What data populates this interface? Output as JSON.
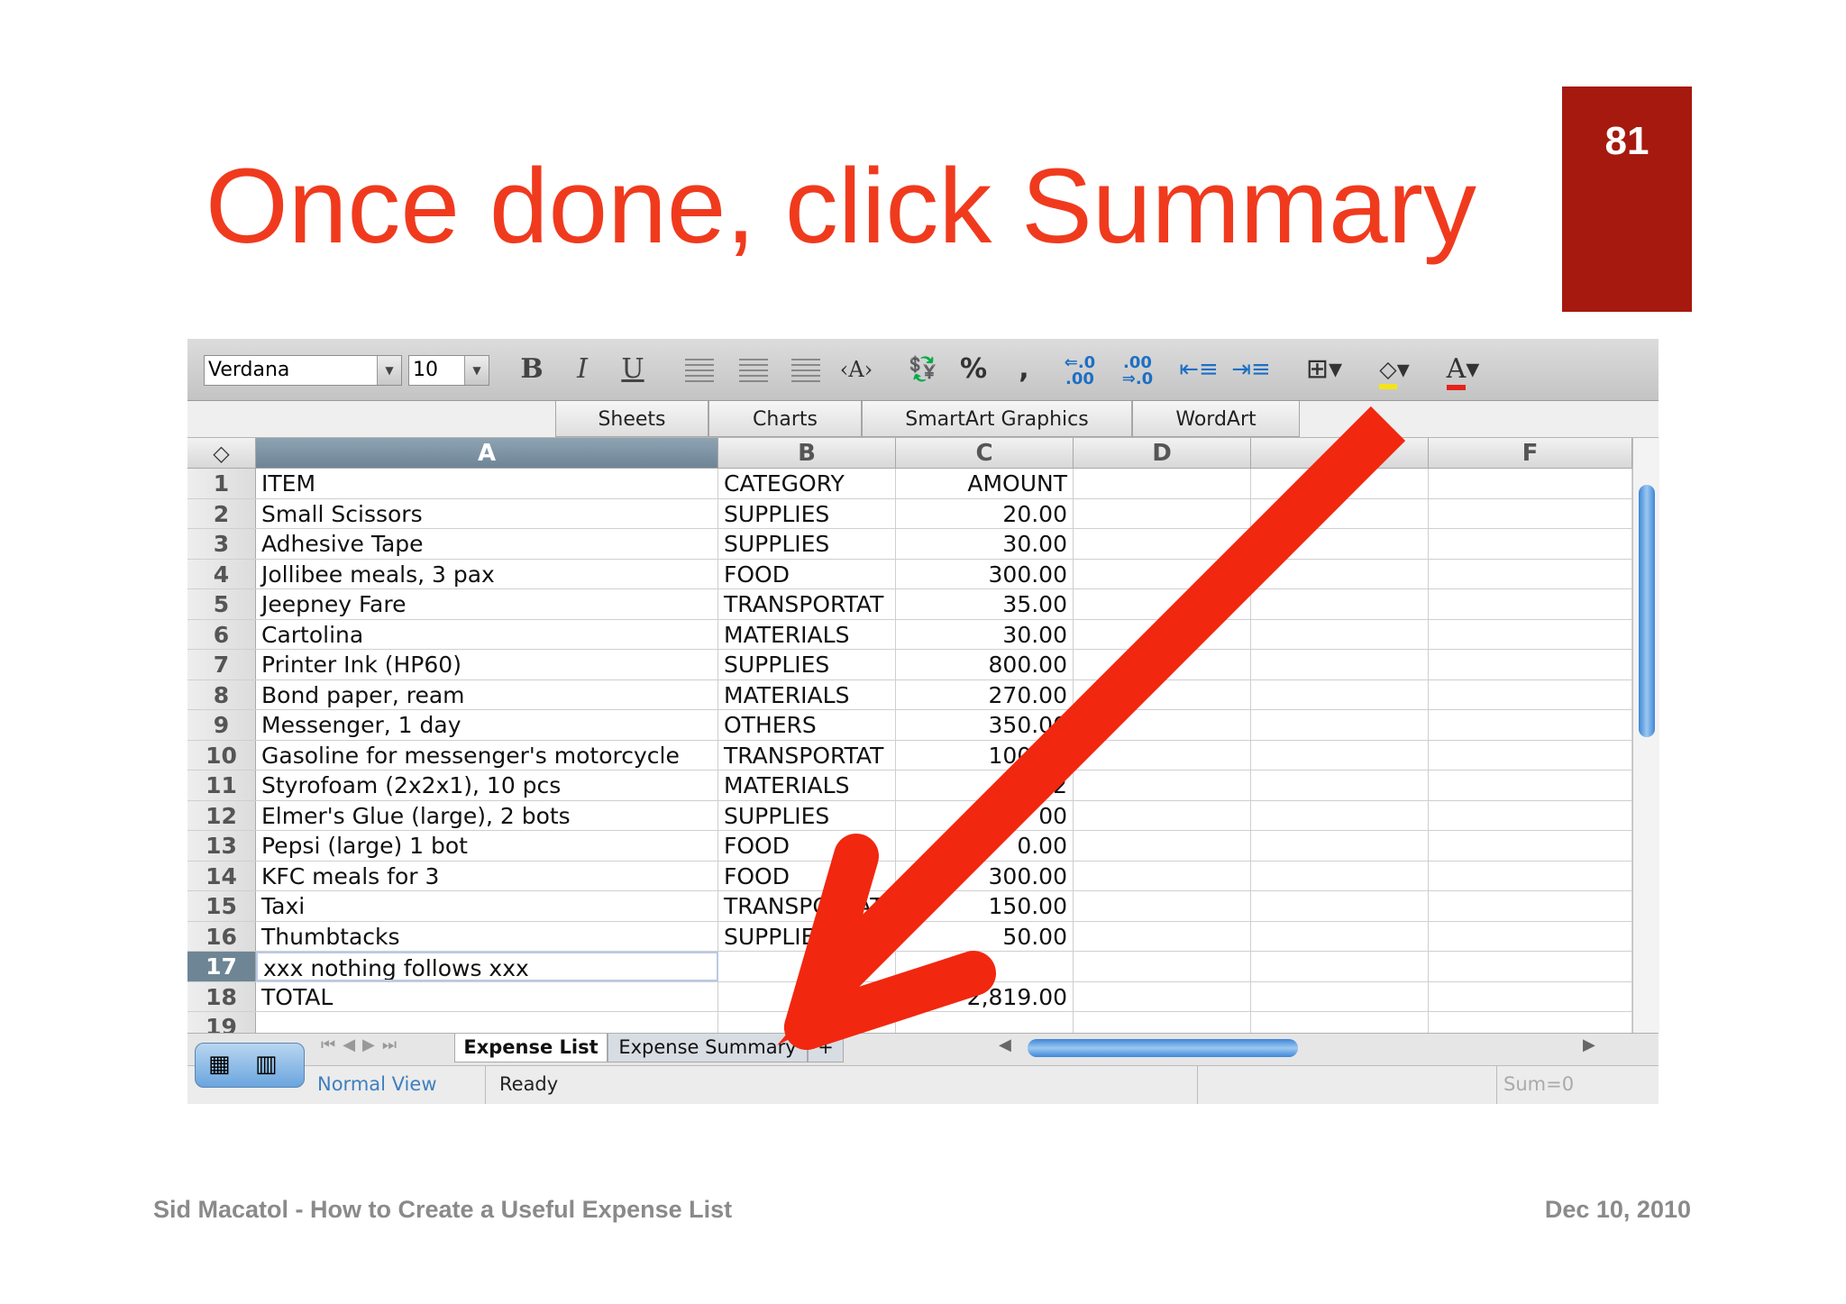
{
  "slide": {
    "title": "Once done, click Summary",
    "page_number": "81",
    "footer_left": "Sid Macatol - How to Create a Useful Expense List",
    "footer_right": "Dec 10, 2010"
  },
  "toolbar": {
    "font_name": "Verdana",
    "font_size": "10",
    "bold": "B",
    "italic": "I",
    "underline": "U",
    "percent": "%",
    "comma": ",",
    "font_color": "A"
  },
  "gallery_tabs": [
    "Sheets",
    "Charts",
    "SmartArt Graphics",
    "WordArt"
  ],
  "columns": [
    "A",
    "B",
    "C",
    "D",
    "E",
    "F"
  ],
  "rows": [
    {
      "n": "1",
      "a": "ITEM",
      "b": "CATEGORY",
      "c": "AMOUNT"
    },
    {
      "n": "2",
      "a": "Small Scissors",
      "b": "SUPPLIES",
      "c": "20.00"
    },
    {
      "n": "3",
      "a": "Adhesive Tape",
      "b": "SUPPLIES",
      "c": "30.00"
    },
    {
      "n": "4",
      "a": "Jollibee meals, 3 pax",
      "b": "FOOD",
      "c": "300.00"
    },
    {
      "n": "5",
      "a": "Jeepney Fare",
      "b": "TRANSPORTAT",
      "c": "35.00"
    },
    {
      "n": "6",
      "a": "Cartolina",
      "b": "MATERIALS",
      "c": "30.00"
    },
    {
      "n": "7",
      "a": "Printer Ink (HP60)",
      "b": "SUPPLIES",
      "c": "800.00"
    },
    {
      "n": "8",
      "a": "Bond paper,  ream",
      "b": "MATERIALS",
      "c": "270.00"
    },
    {
      "n": "9",
      "a": "Messenger, 1 day",
      "b": "OTHERS",
      "c": "350.00"
    },
    {
      "n": "10",
      "a": "Gasoline for messenger's motorcycle",
      "b": "TRANSPORTAT",
      "c": "100.00"
    },
    {
      "n": "11",
      "a": "Styrofoam (2x2x1), 10 pcs",
      "b": "MATERIALS",
      "c": "22"
    },
    {
      "n": "12",
      "a": "Elmer's Glue (large), 2 bots",
      "b": "SUPPLIES",
      "c": "00"
    },
    {
      "n": "13",
      "a": "Pepsi (large) 1 bot",
      "b": "FOOD",
      "c": "0.00"
    },
    {
      "n": "14",
      "a": "KFC meals for 3",
      "b": "FOOD",
      "c": "300.00"
    },
    {
      "n": "15",
      "a": "Taxi",
      "b": "TRANSPORTAT",
      "c": "150.00"
    },
    {
      "n": "16",
      "a": "Thumbtacks",
      "b": "SUPPLIES",
      "c": "50.00"
    },
    {
      "n": "17",
      "a": "xxx nothing follows xxx",
      "b": "",
      "c": ""
    },
    {
      "n": "18",
      "a": "TOTAL",
      "b": "",
      "c": "2,819.00"
    },
    {
      "n": "19",
      "a": "",
      "b": "",
      "c": ""
    }
  ],
  "sheet_tabs": {
    "active": "Expense List",
    "other": "Expense Summary",
    "add": "+"
  },
  "status": {
    "view": "Normal View",
    "state": "Ready",
    "sum": "Sum=0"
  },
  "colors": {
    "title": "#f03a1e",
    "page_box": "#a6190e",
    "arrow": "#f2270f",
    "footer": "#8a8a8a"
  }
}
